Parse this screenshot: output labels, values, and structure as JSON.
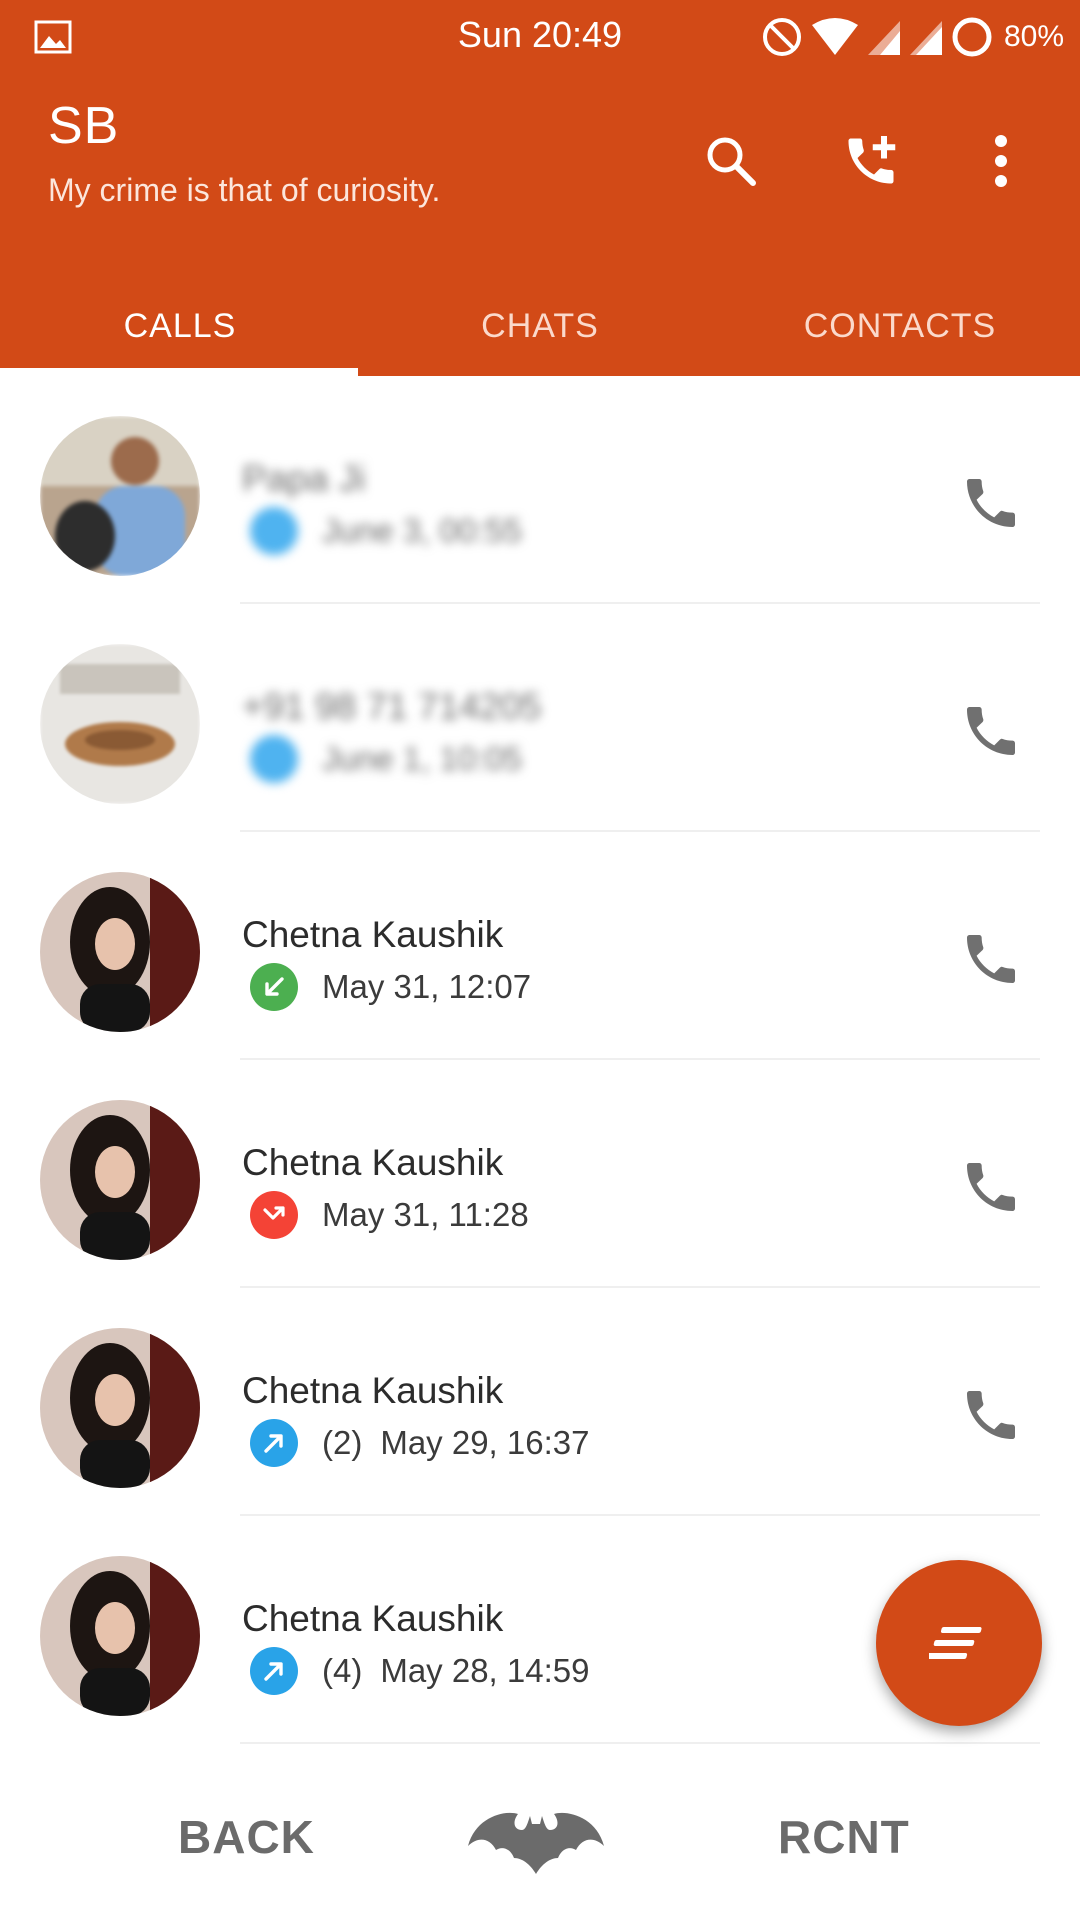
{
  "status_bar": {
    "time": "Sun 20:49",
    "battery": "80%",
    "icons": [
      "gallery-icon",
      "do-not-disturb-icon",
      "wifi-icon",
      "signal-icon",
      "signal-icon",
      "battery-ring-icon"
    ]
  },
  "app_bar": {
    "title": "SB",
    "subtitle": "My crime is that of curiosity.",
    "actions": [
      "search-icon",
      "add-call-icon",
      "more-vert-icon"
    ],
    "color": "#d24a17"
  },
  "tabs": [
    {
      "label": "CALLS",
      "active": true
    },
    {
      "label": "CHATS",
      "active": false
    },
    {
      "label": "CONTACTS",
      "active": false
    }
  ],
  "calls": [
    {
      "name": "Papa Ji",
      "count": "",
      "datetime": "June 3, 00:55",
      "direction": "blurred",
      "blurred": true
    },
    {
      "name": "+91 98 71 714205",
      "count": "",
      "datetime": "June 1, 10:05",
      "direction": "blurred",
      "blurred": true
    },
    {
      "name": "Chetna Kaushik",
      "count": "",
      "datetime": "May 31, 12:07",
      "direction": "incoming",
      "blurred": false
    },
    {
      "name": "Chetna Kaushik",
      "count": "",
      "datetime": "May 31, 11:28",
      "direction": "missed",
      "blurred": false
    },
    {
      "name": "Chetna Kaushik",
      "count": "(2)",
      "datetime": "May 29, 16:37",
      "direction": "outgoing",
      "blurred": false
    },
    {
      "name": "Chetna Kaushik",
      "count": "(4)",
      "datetime": "May 28, 14:59",
      "direction": "outgoing",
      "blurred": false
    }
  ],
  "colors": {
    "incoming": "#4caf50",
    "missed": "#f44336",
    "outgoing": "#29a3e8",
    "blurred": "#4fb3f0"
  },
  "fab": {
    "icon": "menu-lines-icon"
  },
  "nav": {
    "back": "BACK",
    "home_icon": "batman-logo-icon",
    "recent": "RCNT"
  }
}
